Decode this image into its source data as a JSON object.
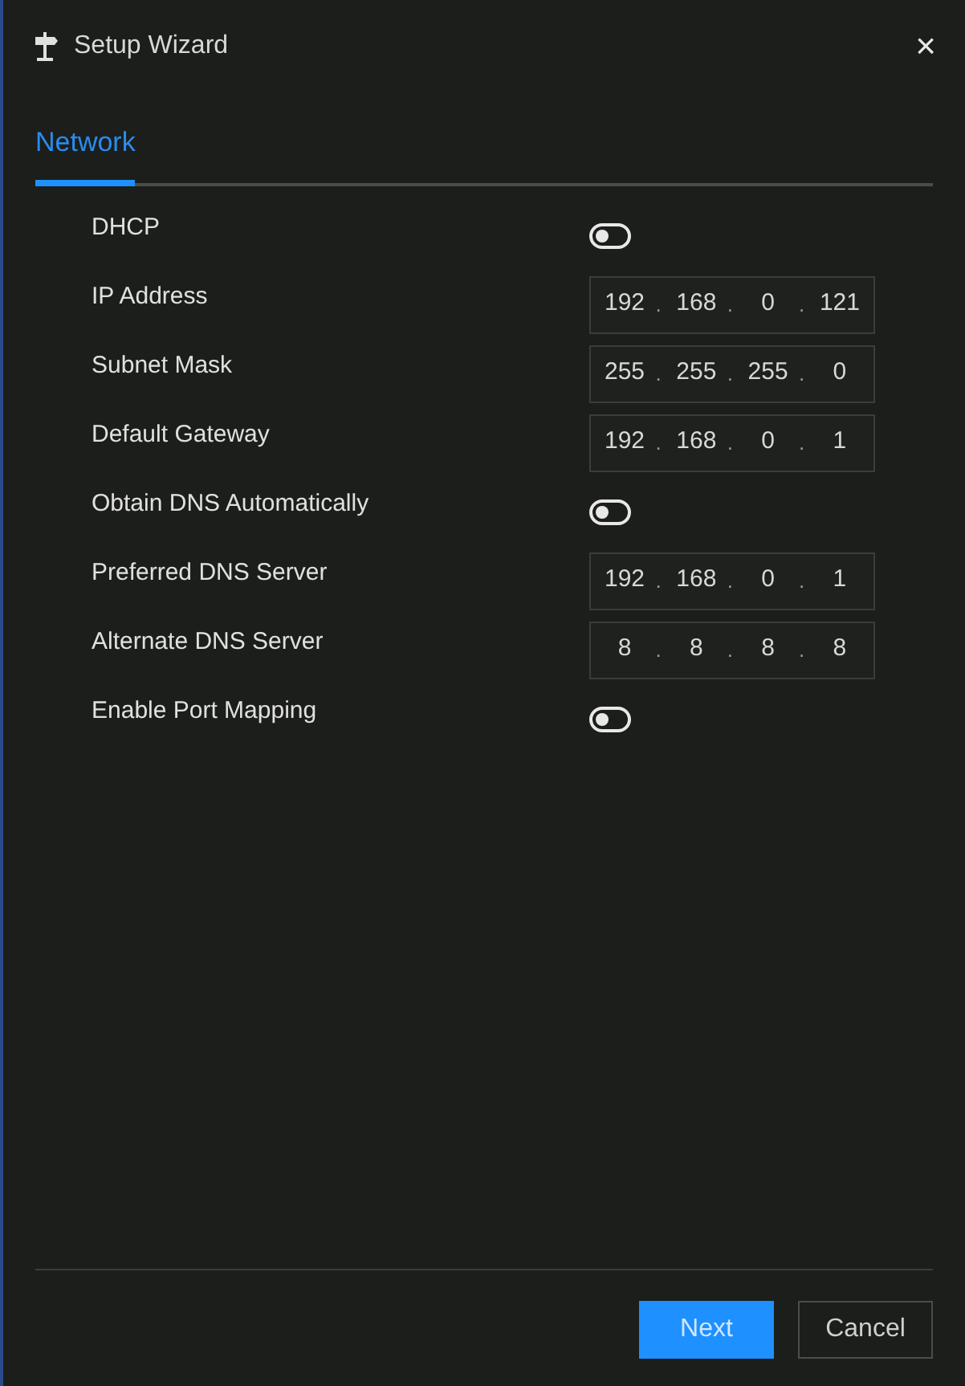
{
  "window": {
    "title": "Setup Wizard",
    "close": "×"
  },
  "tabs": [
    {
      "label": "Network",
      "selected": true
    }
  ],
  "fields": [
    {
      "kind": "toggle",
      "label": "DHCP",
      "on": false
    },
    {
      "kind": "ip",
      "label": "IP Address",
      "octets": [
        "192",
        "168",
        "0",
        "121"
      ],
      "separator": "."
    },
    {
      "kind": "ip",
      "label": "Subnet Mask",
      "octets": [
        "255",
        "255",
        "255",
        "0"
      ],
      "separator": "."
    },
    {
      "kind": "ip",
      "label": "Default Gateway",
      "octets": [
        "192",
        "168",
        "0",
        "1"
      ],
      "separator": "."
    },
    {
      "kind": "toggle",
      "label": "Obtain DNS Automatically",
      "on": false
    },
    {
      "kind": "ip",
      "label": "Preferred DNS Server",
      "octets": [
        "192",
        "168",
        "0",
        "1"
      ],
      "separator": "."
    },
    {
      "kind": "ip",
      "label": "Alternate DNS Server",
      "octets": [
        "8",
        "8",
        "8",
        "8"
      ],
      "separator": "."
    },
    {
      "kind": "toggle",
      "label": "Enable Port Mapping",
      "on": false
    }
  ],
  "buttons": [
    {
      "kind": "primary",
      "label": "Next"
    },
    {
      "kind": "secondary",
      "label": "Cancel"
    }
  ]
}
